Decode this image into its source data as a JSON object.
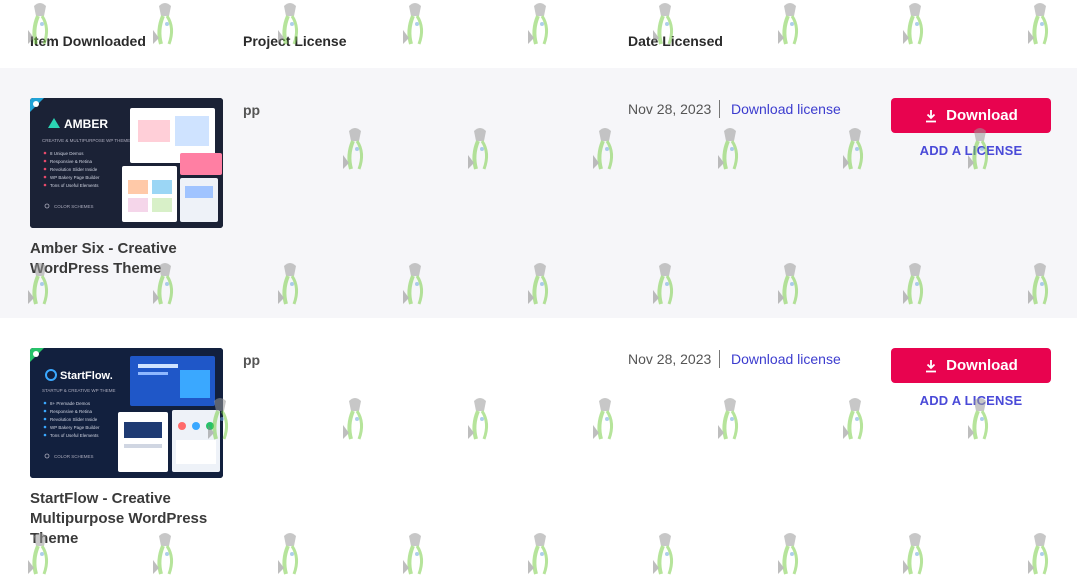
{
  "header": {
    "item_downloaded": "Item Downloaded",
    "project_license": "Project License",
    "date_licensed": "Date Licensed"
  },
  "items": [
    {
      "thumb_brand": "AMBER",
      "thumb_tagline": "CREATIVE & MULTIPURPOSE WP THEME",
      "thumb_features": [
        "8 Unique Demos",
        "Responsive & Retina",
        "Revolution Slider Inside",
        "WP Bakery Page Builder",
        "Tons of Useful Elements"
      ],
      "thumb_footer": "COLOR SCHEMES",
      "name": "Amber Six - Creative WordPress Theme",
      "project": "pp",
      "date": "Nov 28, 2023",
      "download_license": "Download license",
      "download_button": "Download",
      "add_license": "ADD A LICENSE",
      "accent": "#2bd4b4"
    },
    {
      "thumb_brand": "StartFlow.",
      "thumb_tagline": "STARTUP & CREATIVE WP THEME",
      "thumb_features": [
        "8+ Premade Demos",
        "Responsive & Retina",
        "Revolution Slider Inside",
        "WP Bakery Page Builder",
        "Tons of Useful Elements"
      ],
      "thumb_footer": "COLOR SCHEMES",
      "name": "StartFlow - Creative Multipurpose WordPress Theme",
      "project": "pp",
      "date": "Nov 28, 2023",
      "download_license": "Download license",
      "download_button": "Download",
      "add_license": "ADD A LICENSE",
      "accent": "#3aa8ff"
    }
  ],
  "colors": {
    "download_button_bg": "#e8034f",
    "link": "#3c3ccf",
    "row_alt_bg": "#f6f6f9"
  },
  "icons": {
    "download": "download-arrow-icon",
    "wordpress": "wordpress-badge-icon",
    "watermark": "watering-can-watermark-icon"
  }
}
